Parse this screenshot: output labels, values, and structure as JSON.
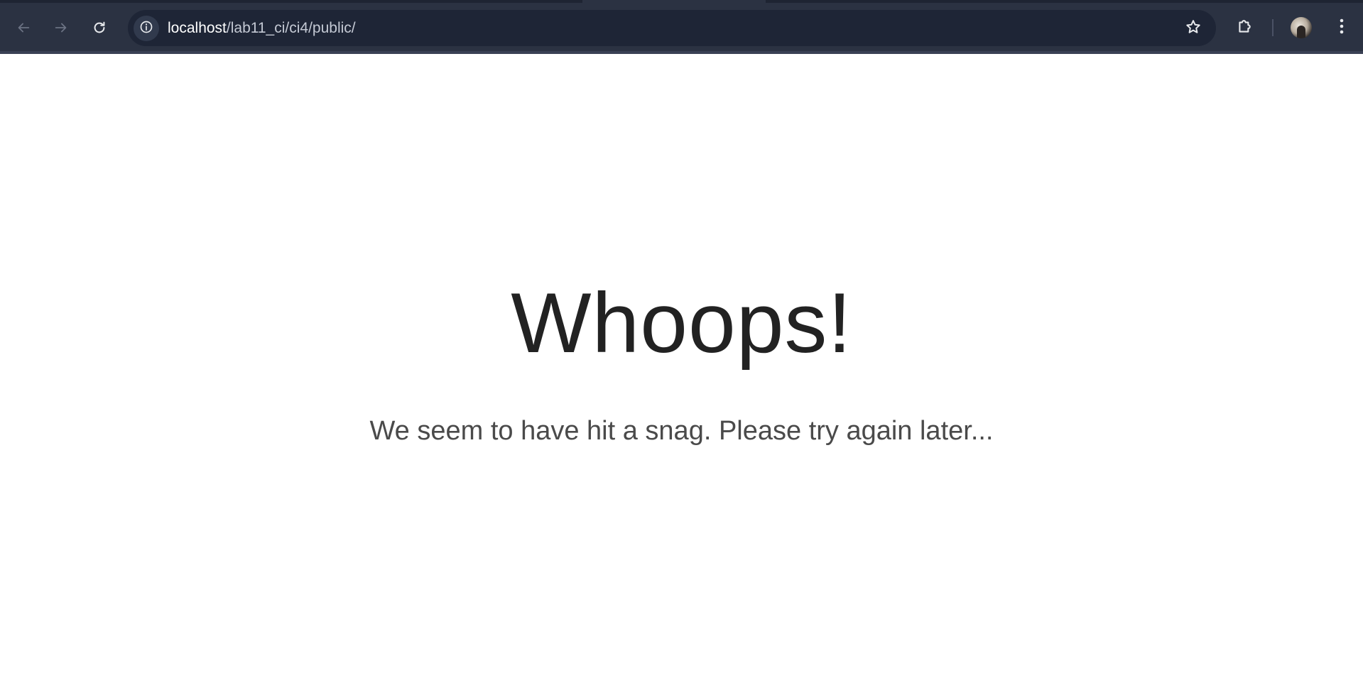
{
  "browser": {
    "url_host": "localhost",
    "url_path": "/lab11_ci/ci4/public/",
    "icons": {
      "back": "arrow-left-icon",
      "forward": "arrow-right-icon",
      "reload": "reload-icon",
      "site_info": "info-icon",
      "bookmark": "star-icon",
      "extensions": "puzzle-icon",
      "profile": "avatar",
      "menu": "kebab-menu-icon"
    },
    "colors": {
      "toolbar": "#2b3242",
      "omnibox": "#1e2536",
      "text": "#e8eaed"
    }
  },
  "page": {
    "headline": "Whoops!",
    "message": "We seem to have hit a snag. Please try again later...",
    "colors": {
      "background": "#ffffff",
      "headline": "#222222",
      "message": "#4a4a4a"
    }
  }
}
